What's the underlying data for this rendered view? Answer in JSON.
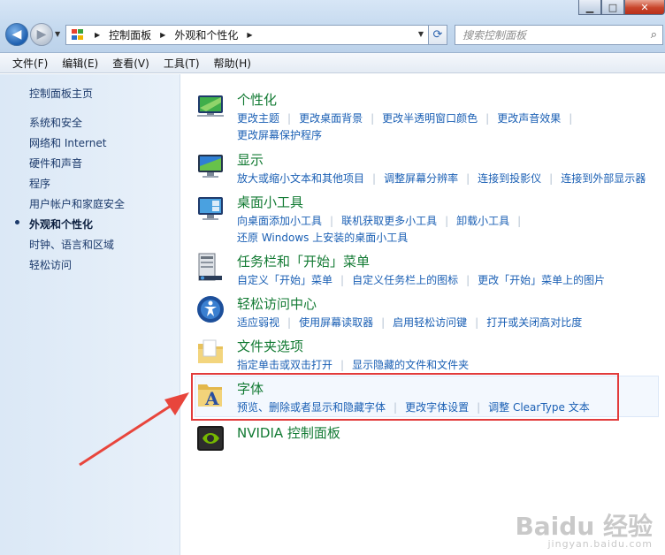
{
  "address": {
    "crumbs": [
      "控制面板",
      "外观和个性化"
    ]
  },
  "search": {
    "placeholder": "搜索控制面板"
  },
  "menu": [
    "文件(F)",
    "编辑(E)",
    "查看(V)",
    "工具(T)",
    "帮助(H)"
  ],
  "sidebar": {
    "home": "控制面板主页",
    "items": [
      {
        "label": "系统和安全"
      },
      {
        "label": "网络和 Internet"
      },
      {
        "label": "硬件和声音"
      },
      {
        "label": "程序"
      },
      {
        "label": "用户帐户和家庭安全"
      },
      {
        "label": "外观和个性化"
      },
      {
        "label": "时钟、语言和区域"
      },
      {
        "label": "轻松访问"
      }
    ]
  },
  "categories": [
    {
      "title": "个性化",
      "icon": "personalization-icon",
      "links": [
        "更改主题",
        "更改桌面背景",
        "更改半透明窗口颜色",
        "更改声音效果",
        "更改屏幕保护程序"
      ]
    },
    {
      "title": "显示",
      "icon": "display-icon",
      "links": [
        "放大或缩小文本和其他项目",
        "调整屏幕分辨率",
        "连接到投影仪",
        "连接到外部显示器"
      ]
    },
    {
      "title": "桌面小工具",
      "icon": "gadgets-icon",
      "links": [
        "向桌面添加小工具",
        "联机获取更多小工具",
        "卸载小工具",
        "还原 Windows 上安装的桌面小工具"
      ]
    },
    {
      "title": "任务栏和「开始」菜单",
      "icon": "taskbar-icon",
      "links": [
        "自定义「开始」菜单",
        "自定义任务栏上的图标",
        "更改「开始」菜单上的图片"
      ]
    },
    {
      "title": "轻松访问中心",
      "icon": "ease-of-access-icon",
      "links": [
        "适应弱视",
        "使用屏幕读取器",
        "启用轻松访问键",
        "打开或关闭高对比度"
      ]
    },
    {
      "title": "文件夹选项",
      "icon": "folder-options-icon",
      "links": [
        "指定单击或双击打开",
        "显示隐藏的文件和文件夹"
      ]
    },
    {
      "title": "字体",
      "icon": "fonts-icon",
      "links": [
        "预览、删除或者显示和隐藏字体",
        "更改字体设置",
        "调整 ClearType 文本"
      ]
    },
    {
      "title": "NVIDIA 控制面板",
      "icon": "nvidia-icon",
      "links": []
    }
  ],
  "watermark": {
    "main": "Baidu 经验",
    "sub": "jingyan.baidu.com"
  }
}
